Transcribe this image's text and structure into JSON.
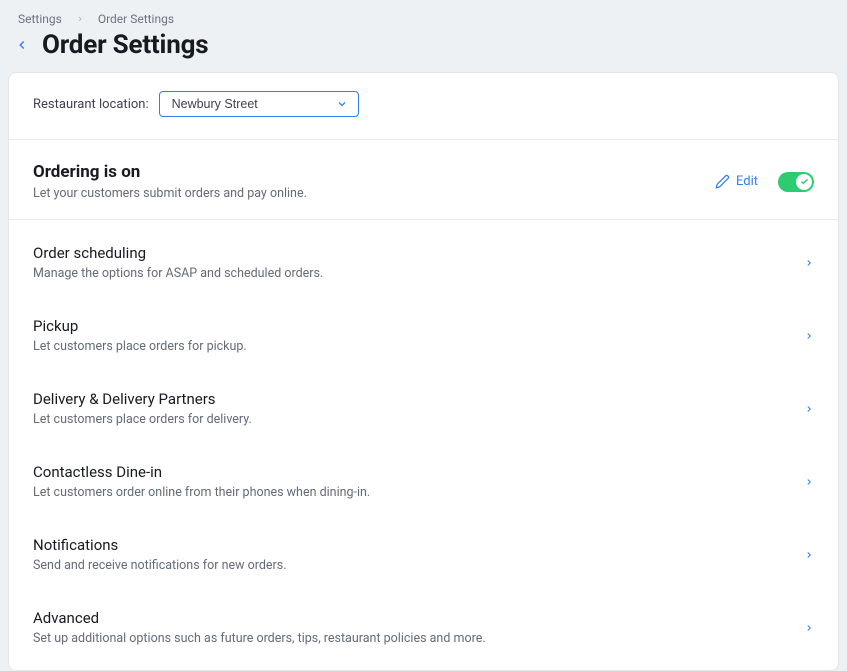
{
  "breadcrumb": {
    "root": "Settings",
    "current": "Order Settings"
  },
  "page_title": "Order Settings",
  "location": {
    "label": "Restaurant location:",
    "selected": "Newbury Street"
  },
  "ordering": {
    "title": "Ordering is on",
    "subtitle": "Let your customers submit orders and pay online.",
    "edit_label": "Edit",
    "enabled": true
  },
  "sections": [
    {
      "title": "Order scheduling",
      "subtitle": "Manage the options for ASAP and scheduled orders."
    },
    {
      "title": "Pickup",
      "subtitle": "Let customers place orders for pickup."
    },
    {
      "title": "Delivery & Delivery Partners",
      "subtitle": "Let customers place orders for delivery."
    },
    {
      "title": "Contactless Dine-in",
      "subtitle": "Let customers order online from their phones when dining-in."
    },
    {
      "title": "Notifications",
      "subtitle": "Send and receive notifications for new orders."
    },
    {
      "title": "Advanced",
      "subtitle": "Set up additional options such as future orders, tips, restaurant policies and more."
    }
  ]
}
